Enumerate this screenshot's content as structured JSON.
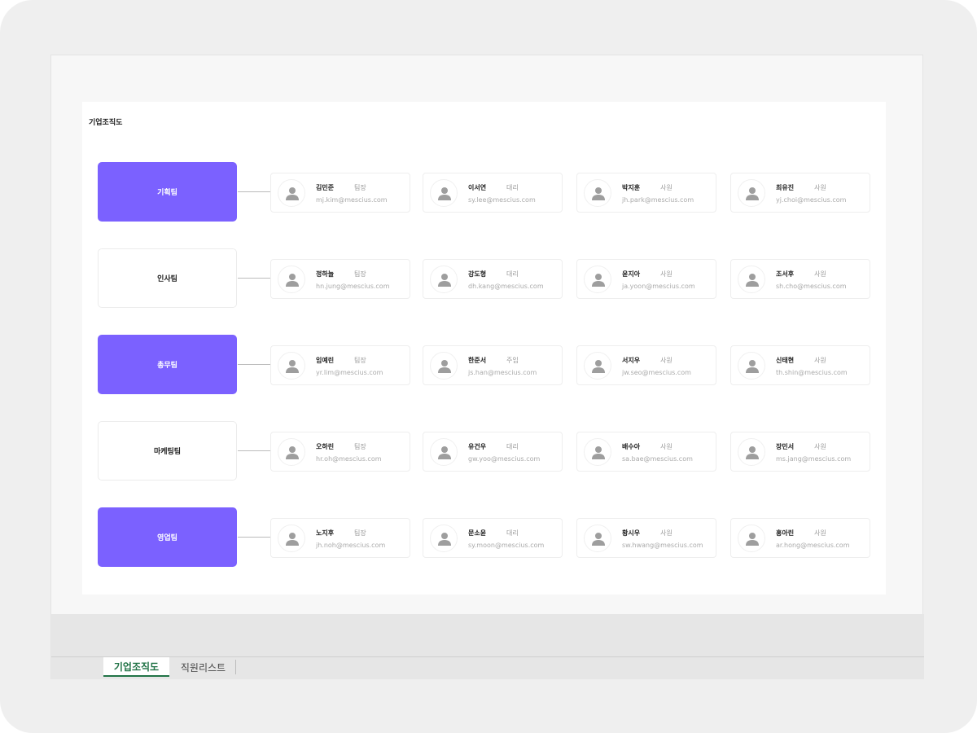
{
  "sheet_title": "기업조직도",
  "accent": "#7b61ff",
  "teams": [
    {
      "name": "기획팀",
      "filled": true,
      "members": [
        {
          "name": "김민준",
          "rank": "팀장",
          "email": "mj.kim@mescius.com"
        },
        {
          "name": "이서연",
          "rank": "대리",
          "email": "sy.lee@mescius.com"
        },
        {
          "name": "박지훈",
          "rank": "사원",
          "email": "jh.park@mescius.com"
        },
        {
          "name": "최유진",
          "rank": "사원",
          "email": "yj.choi@mescius.com"
        }
      ]
    },
    {
      "name": "인사팀",
      "filled": false,
      "members": [
        {
          "name": "정하늘",
          "rank": "팀장",
          "email": "hn.jung@mescius.com"
        },
        {
          "name": "강도형",
          "rank": "대리",
          "email": "dh.kang@mescius.com"
        },
        {
          "name": "윤지아",
          "rank": "사원",
          "email": "ja.yoon@mescius.com"
        },
        {
          "name": "조서후",
          "rank": "사원",
          "email": "sh.cho@mescius.com"
        }
      ]
    },
    {
      "name": "총무팀",
      "filled": true,
      "members": [
        {
          "name": "임예린",
          "rank": "팀장",
          "email": "yr.lim@mescius.com"
        },
        {
          "name": "한준서",
          "rank": "주임",
          "email": "js.han@mescius.com"
        },
        {
          "name": "서지우",
          "rank": "사원",
          "email": "jw.seo@mescius.com"
        },
        {
          "name": "신태현",
          "rank": "사원",
          "email": "th.shin@mescius.com"
        }
      ]
    },
    {
      "name": "마케팅팀",
      "filled": false,
      "members": [
        {
          "name": "오하린",
          "rank": "팀장",
          "email": "hr.oh@mescius.com"
        },
        {
          "name": "유건우",
          "rank": "대리",
          "email": "gw.yoo@mescius.com"
        },
        {
          "name": "배수아",
          "rank": "사원",
          "email": "sa.bae@mescius.com"
        },
        {
          "name": "장민서",
          "rank": "사원",
          "email": "ms.jang@mescius.com"
        }
      ]
    },
    {
      "name": "영업팀",
      "filled": true,
      "members": [
        {
          "name": "노지후",
          "rank": "팀장",
          "email": "jh.noh@mescius.com"
        },
        {
          "name": "문소윤",
          "rank": "대리",
          "email": "sy.moon@mescius.com"
        },
        {
          "name": "황시우",
          "rank": "사원",
          "email": "sw.hwang@mescius.com"
        },
        {
          "name": "홍아린",
          "rank": "사원",
          "email": "ar.hong@mescius.com"
        }
      ]
    }
  ],
  "sheet_tabs": [
    "기업조직도",
    "직원리스트"
  ]
}
